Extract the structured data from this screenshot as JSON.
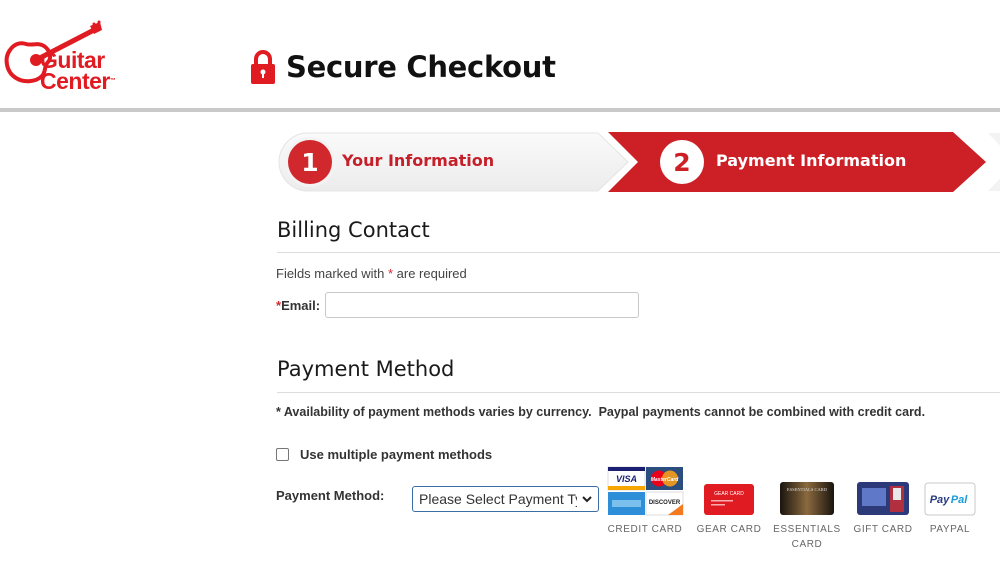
{
  "header": {
    "brand_line1": "Guitar",
    "brand_line2": "Center",
    "brand_tm": "™",
    "title": "Secure Checkout",
    "lock_icon": "lock-icon"
  },
  "stepper": {
    "steps": [
      {
        "number": "1",
        "label": "Your Information",
        "state": "completed"
      },
      {
        "number": "2",
        "label": "Payment Information",
        "state": "active"
      }
    ],
    "colors": {
      "active": "#cc2026",
      "inactive_bg": "#f2f2f2"
    }
  },
  "billing": {
    "heading": "Billing Contact",
    "required_note_prefix": "Fields marked with ",
    "required_star": "*",
    "required_note_suffix": " are required",
    "email_star": "*",
    "email_label": "Email:",
    "email_value": "",
    "email_placeholder": ""
  },
  "payment": {
    "heading": "Payment Method",
    "availability_note": "* Availability of payment methods varies by currency.  Paypal payments cannot be combined with credit card.",
    "multiple_label": "Use multiple payment methods",
    "multiple_checked": false,
    "method_label": "Payment Method:",
    "select_value": "Please Select Payment Type",
    "options": [
      {
        "caption": "CREDIT CARD",
        "icon": "credit-cards-icon"
      },
      {
        "caption": "GEAR CARD",
        "icon": "gear-card-icon"
      },
      {
        "caption_line1": "ESSENTIALS",
        "caption_line2": "CARD",
        "icon": "essentials-card-icon"
      },
      {
        "caption": "GIFT CARD",
        "icon": "gift-card-icon"
      },
      {
        "caption": "PAYPAL",
        "icon": "paypal-icon"
      }
    ],
    "card_logos": {
      "visa": "VISA",
      "mastercard": "MasterCard",
      "amex": "AMERICAN EXPRESS",
      "discover": "DISCOVER",
      "gear": "GEAR CARD",
      "essentials": "ESSENTIALS CARD",
      "paypal_a": "Pay",
      "paypal_b": "Pal"
    }
  },
  "colors": {
    "brand_red": "#e11b22",
    "link_blue": "#3a6ea5"
  }
}
